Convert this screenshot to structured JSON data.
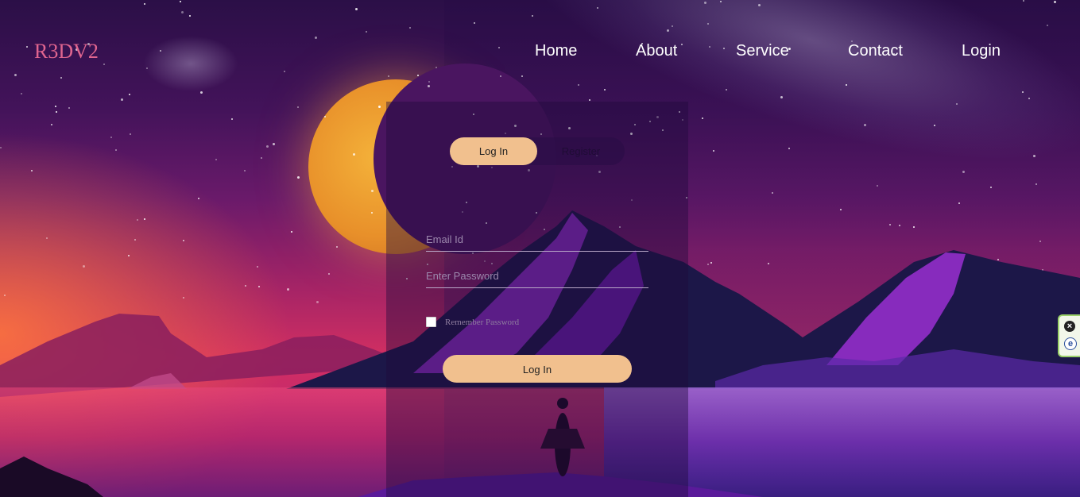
{
  "brand": {
    "name": "R3DV2"
  },
  "nav": {
    "items": [
      {
        "label": "Home"
      },
      {
        "label": "About"
      },
      {
        "label": "Service"
      },
      {
        "label": "Contact"
      },
      {
        "label": "Login"
      }
    ]
  },
  "auth": {
    "tabs": {
      "login": "Log In",
      "register": "Register"
    },
    "email_placeholder": "Email Id",
    "password_placeholder": "Enter Password",
    "remember_label": "Remember Password",
    "submit_label": "Log In"
  },
  "side_widget": {
    "close_icon": "close-icon",
    "e_icon": "e-icon",
    "close_glyph": "×",
    "e_glyph": "e"
  },
  "colors": {
    "brand": "#e0658f",
    "accent_button": "#f1c08e",
    "nav_text": "#ffffff",
    "moon": "#f4b23a"
  }
}
